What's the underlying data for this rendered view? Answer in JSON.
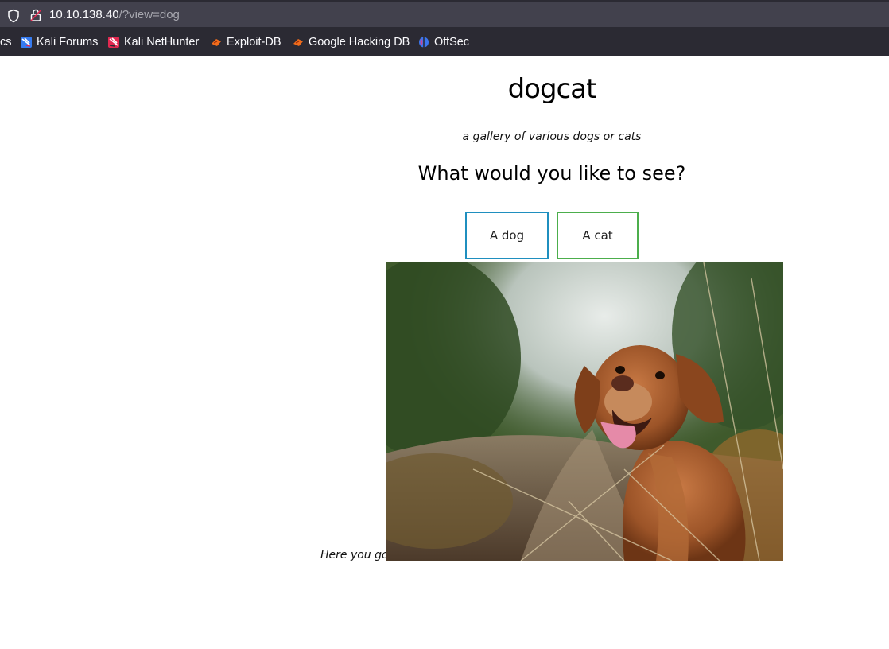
{
  "browser": {
    "url_host": "10.10.138.40",
    "url_path": "/?view=dog",
    "bookmarks": [
      {
        "label": "cs",
        "icon": "truncated"
      },
      {
        "label": "Kali Forums",
        "icon": "kali-forums-icon"
      },
      {
        "label": "Kali NetHunter",
        "icon": "kali-nethunter-icon"
      },
      {
        "label": "Exploit-DB",
        "icon": "exploit-db-icon"
      },
      {
        "label": "Google Hacking DB",
        "icon": "ghdb-icon"
      },
      {
        "label": "OffSec",
        "icon": "offsec-icon"
      }
    ]
  },
  "page": {
    "title": "dogcat",
    "subtitle": "a gallery of various dogs or cats",
    "question": "What would you like to see?",
    "buttons": {
      "dog": "A dog",
      "cat": "A cat"
    },
    "caption": "Here you go!",
    "image_subject": "dog"
  },
  "colors": {
    "dog_button_border": "#1f8fbf",
    "cat_button_border": "#4cae4c",
    "chrome_bg": "#2b2a33"
  }
}
